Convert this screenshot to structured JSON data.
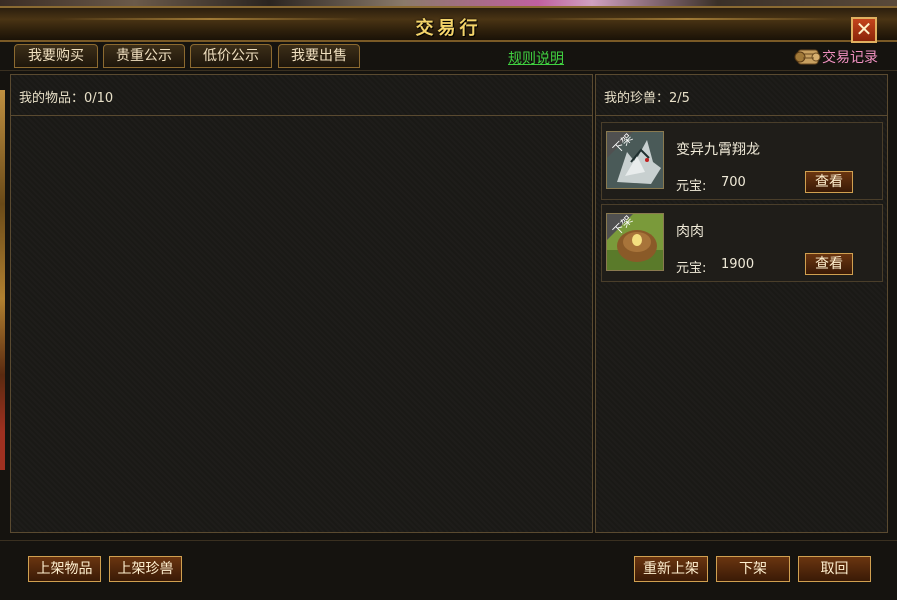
{
  "window": {
    "title": "交易行",
    "close_label": "✕"
  },
  "tabs": [
    {
      "label": "我要购买"
    },
    {
      "label": "贵重公示"
    },
    {
      "label": "低价公示"
    },
    {
      "label": "我要出售"
    }
  ],
  "rules_link": "规则说明",
  "trade_record": "交易记录",
  "items_panel": {
    "label": "我的物品：0/10"
  },
  "pets_panel": {
    "label": "我的珍兽：2/5",
    "pets": [
      {
        "badge": "下架",
        "name": "变异九霄翔龙",
        "price_label": "元宝:",
        "price": "700",
        "view_label": "查看"
      },
      {
        "badge": "下架",
        "name": "肉肉",
        "price_label": "元宝:",
        "price": "1900",
        "view_label": "查看"
      }
    ]
  },
  "bottom_buttons": {
    "list_item": "上架物品",
    "list_pet": "上架珍兽",
    "relist": "重新上架",
    "delist": "下架",
    "withdraw": "取回"
  },
  "colors": {
    "title": "#f4d46a",
    "link": "#40d040",
    "trade_record": "#f090c0",
    "button_border": "#d0a050"
  }
}
